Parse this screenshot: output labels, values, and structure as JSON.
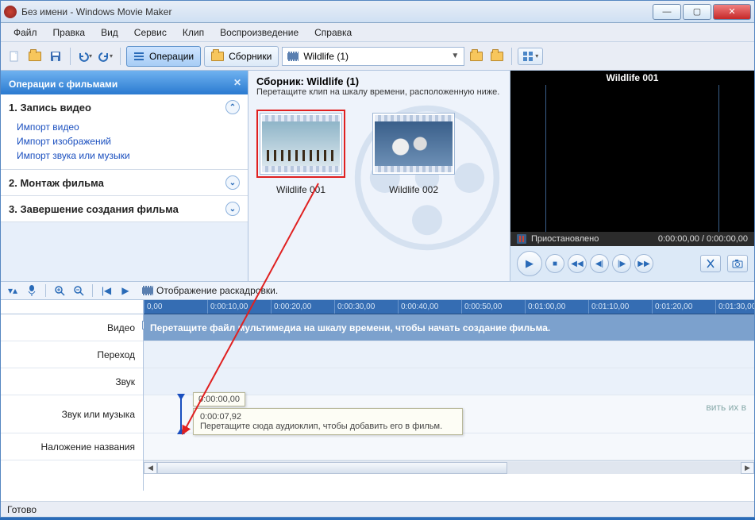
{
  "window": {
    "title": "Без имени - Windows Movie Maker"
  },
  "menu": {
    "file": "Файл",
    "edit": "Правка",
    "view": "Вид",
    "service": "Сервис",
    "clip": "Клип",
    "playback": "Воспроизведение",
    "help": "Справка"
  },
  "toolbar": {
    "operations": "Операции",
    "collections": "Сборники",
    "collection_selected": "Wildlife (1)"
  },
  "tasks": {
    "header": "Операции с фильмами",
    "group1_title": "1. Запись видео",
    "group1_links": {
      "l1": "Импорт видео",
      "l2": "Импорт изображений",
      "l3": "Импорт звука или музыки"
    },
    "group2_title": "2. Монтаж фильма",
    "group3_title": "3. Завершение создания фильма"
  },
  "collection": {
    "title": "Сборник: Wildlife (1)",
    "subtitle": "Перетащите клип на шкалу времени, расположенную ниже.",
    "clip1_label": "Wildlife 001",
    "clip2_label": "Wildlife 002"
  },
  "preview": {
    "title": "Wildlife 001",
    "status": "Приостановлено",
    "time": "0:00:00,00 / 0:00:00,00"
  },
  "timeline_header": {
    "view_label": "Отображение раскадровки."
  },
  "timeline": {
    "ruler": [
      "0,00",
      "0:00:10,00",
      "0:00:20,00",
      "0:00:30,00",
      "0:00:40,00",
      "0:00:50,00",
      "0:01:00,00",
      "0:01:10,00",
      "0:01:20,00",
      "0:01:30,00"
    ],
    "rows": {
      "video": "Видео",
      "transition": "Переход",
      "sound": "Звук",
      "music": "Звук или музыка",
      "title": "Наложение названия"
    },
    "video_hint": "Перетащите файл мультимедиа на шкалу времени, чтобы начать создание фильма.",
    "drop_hint_partial": "вить их в"
  },
  "tooltip": {
    "time1": "0:00:00,00",
    "time2": "0:00:07,92",
    "text": "Перетащите сюда аудиоклип, чтобы добавить его в фильм."
  },
  "statusbar": {
    "text": "Готово"
  }
}
